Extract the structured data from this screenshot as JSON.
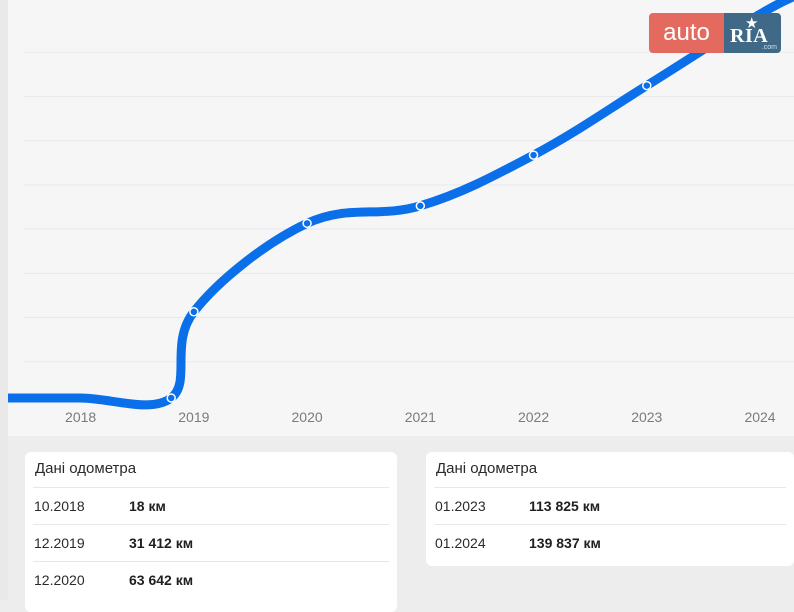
{
  "chart_data": {
    "type": "line",
    "x": [
      2018,
      2018.8,
      2019,
      2020,
      2021,
      2022,
      2023,
      2024
    ],
    "values": [
      0,
      18,
      31412,
      63642,
      70000,
      88500,
      113825,
      139837
    ],
    "xticks": [
      "2018",
      "2019",
      "2020",
      "2021",
      "2022",
      "2023",
      "2024"
    ],
    "xlim": [
      2017.5,
      2024.3
    ],
    "ylim": [
      0,
      145000
    ],
    "grid": true,
    "line_color": "#0a6fe8",
    "marker_years": [
      2018.8,
      2019,
      2020,
      2021,
      2022,
      2023
    ]
  },
  "logo": {
    "left": "auto",
    "right": "RIA",
    "sub": ".com"
  },
  "odometer_left": {
    "title": "Дані одометра",
    "rows": [
      {
        "date": "10.2018",
        "km": "18 км"
      },
      {
        "date": "12.2019",
        "km": "31 412 км"
      },
      {
        "date": "12.2020",
        "km": "63 642 км"
      }
    ]
  },
  "odometer_right": {
    "title": "Дані одометра",
    "rows": [
      {
        "date": "01.2023",
        "km": "113 825 км"
      },
      {
        "date": "01.2024",
        "km": "139 837 км"
      }
    ]
  }
}
